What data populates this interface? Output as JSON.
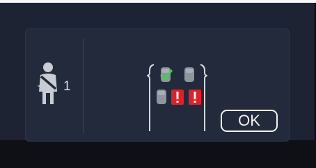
{
  "occupant_indicator": {
    "icon": "person-seatbelt-icon",
    "count": "1"
  },
  "seat_status": {
    "front_left": {
      "status": "buckled",
      "icon": "seat-check-icon"
    },
    "front_right": {
      "status": "empty",
      "icon": "seat-icon"
    },
    "rear_left": {
      "status": "empty",
      "icon": "seat-icon"
    },
    "rear_center": {
      "status": "unbuckled",
      "icon": "seat-warning-icon",
      "glyph": "!"
    },
    "rear_right": {
      "status": "unbuckled",
      "icon": "seat-warning-icon",
      "glyph": "!"
    }
  },
  "ok_button": {
    "label": "OK"
  },
  "colors": {
    "check": "#3fd24a",
    "warning": "#e01f28",
    "seat": "#8f959e",
    "text": "#f2f2f2"
  }
}
